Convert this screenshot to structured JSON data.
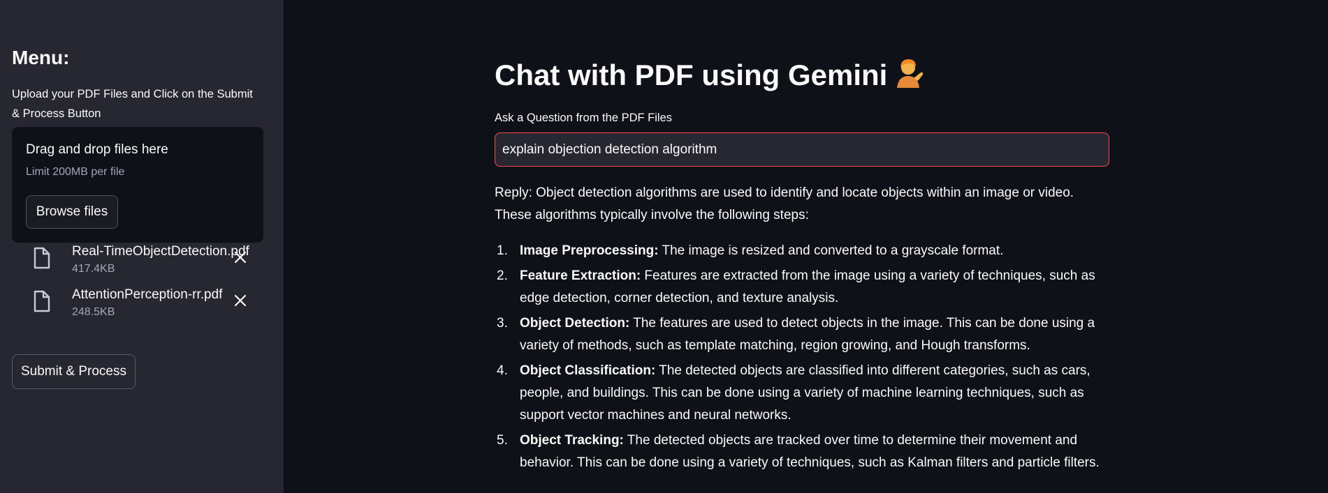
{
  "sidebar": {
    "menu_title": "Menu:",
    "description": "Upload your PDF Files and Click on the Submit & Process Button",
    "dropzone": {
      "title": "Drag and drop files here",
      "limit": "Limit 200MB per file",
      "browse_label": "Browse files"
    },
    "files": [
      {
        "name": "Real-TimeObjectDetection.pdf",
        "size": "417.4KB",
        "icon": "file-icon"
      },
      {
        "name": "AttentionPerception-rr.pdf",
        "size": "248.5KB",
        "icon": "file-icon"
      }
    ],
    "submit_label": "Submit & Process"
  },
  "main": {
    "title": "Chat with PDF using Gemini",
    "title_emoji": "person-tipping-hand-emoji",
    "question_label": "Ask a Question from the PDF Files",
    "question_value": "explain objection detection algorithm",
    "reply_intro": "Reply: Object detection algorithms are used to identify and locate objects within an image or video. These algorithms typically involve the following steps:",
    "steps": [
      {
        "num": "1.",
        "head": "Image Preprocessing:",
        "text": " The image is resized and converted to a grayscale format."
      },
      {
        "num": "2.",
        "head": "Feature Extraction:",
        "text": " Features are extracted from the image using a variety of techniques, such as edge detection, corner detection, and texture analysis."
      },
      {
        "num": "3.",
        "head": "Object Detection:",
        "text": " The features are used to detect objects in the image. This can be done using a variety of methods, such as template matching, region growing, and Hough transforms."
      },
      {
        "num": "4.",
        "head": "Object Classification:",
        "text": " The detected objects are classified into different categories, such as cars, people, and buildings. This can be done using a variety of machine learning techniques, such as support vector machines and neural networks."
      },
      {
        "num": "5.",
        "head": "Object Tracking:",
        "text": " The detected objects are tracked over time to determine their movement and behavior. This can be done using a variety of techniques, such as Kalman filters and particle filters."
      }
    ]
  },
  "colors": {
    "sidebar_bg": "#262730",
    "main_bg": "#0e1117",
    "accent": "#ff4b4b",
    "text": "#fafafa",
    "muted": "#a3a8b8"
  }
}
